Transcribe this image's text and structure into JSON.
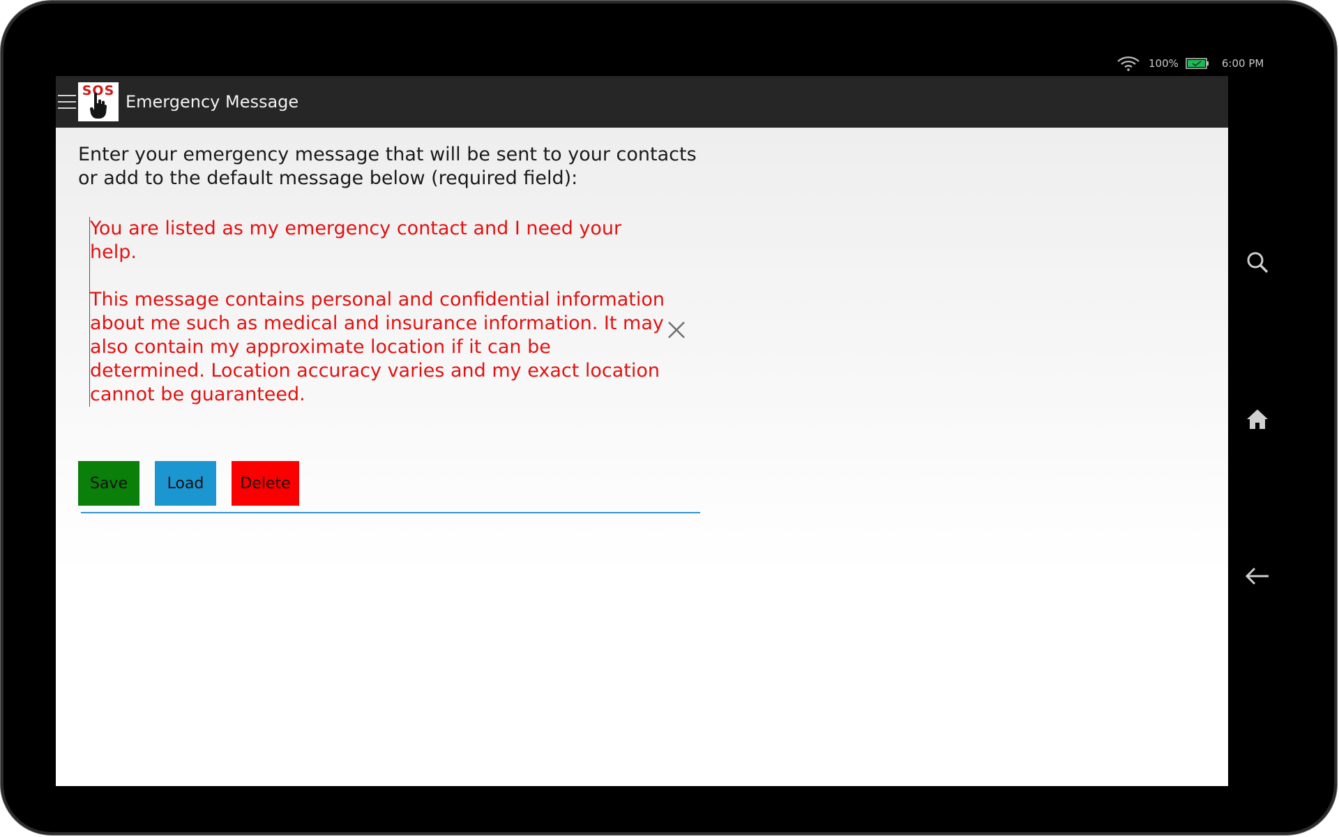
{
  "status_bar": {
    "wifi_icon": "wifi-icon",
    "battery_percent": "100%",
    "battery_icon": "battery-charging-icon",
    "time": "6:00 PM"
  },
  "action_bar": {
    "menu_icon": "hamburger-menu-icon",
    "logo_text": "SOS",
    "title": "Emergency Message"
  },
  "content": {
    "instructions": "Enter your emergency message that will be sent to your contacts or add to the default message below (required field):",
    "message_value": "You are listed as my emergency contact and I need your help.\n\nThis message contains personal and confidential information about me such as medical and insurance information. It may also contain my approximate location if it can be determined. Location accuracy varies and my exact location cannot be guaranteed.",
    "clear_icon": "close-icon"
  },
  "buttons": {
    "save": "Save",
    "load": "Load",
    "delete": "Delete"
  },
  "colors": {
    "save_bg": "#0a7f0a",
    "load_bg": "#1b96d1",
    "delete_bg": "#fb0000",
    "message_text": "#e11212",
    "field_underline": "#2e93c9"
  },
  "system_nav": {
    "search_icon": "search-icon",
    "home_icon": "home-icon",
    "back_icon": "back-arrow-icon"
  }
}
